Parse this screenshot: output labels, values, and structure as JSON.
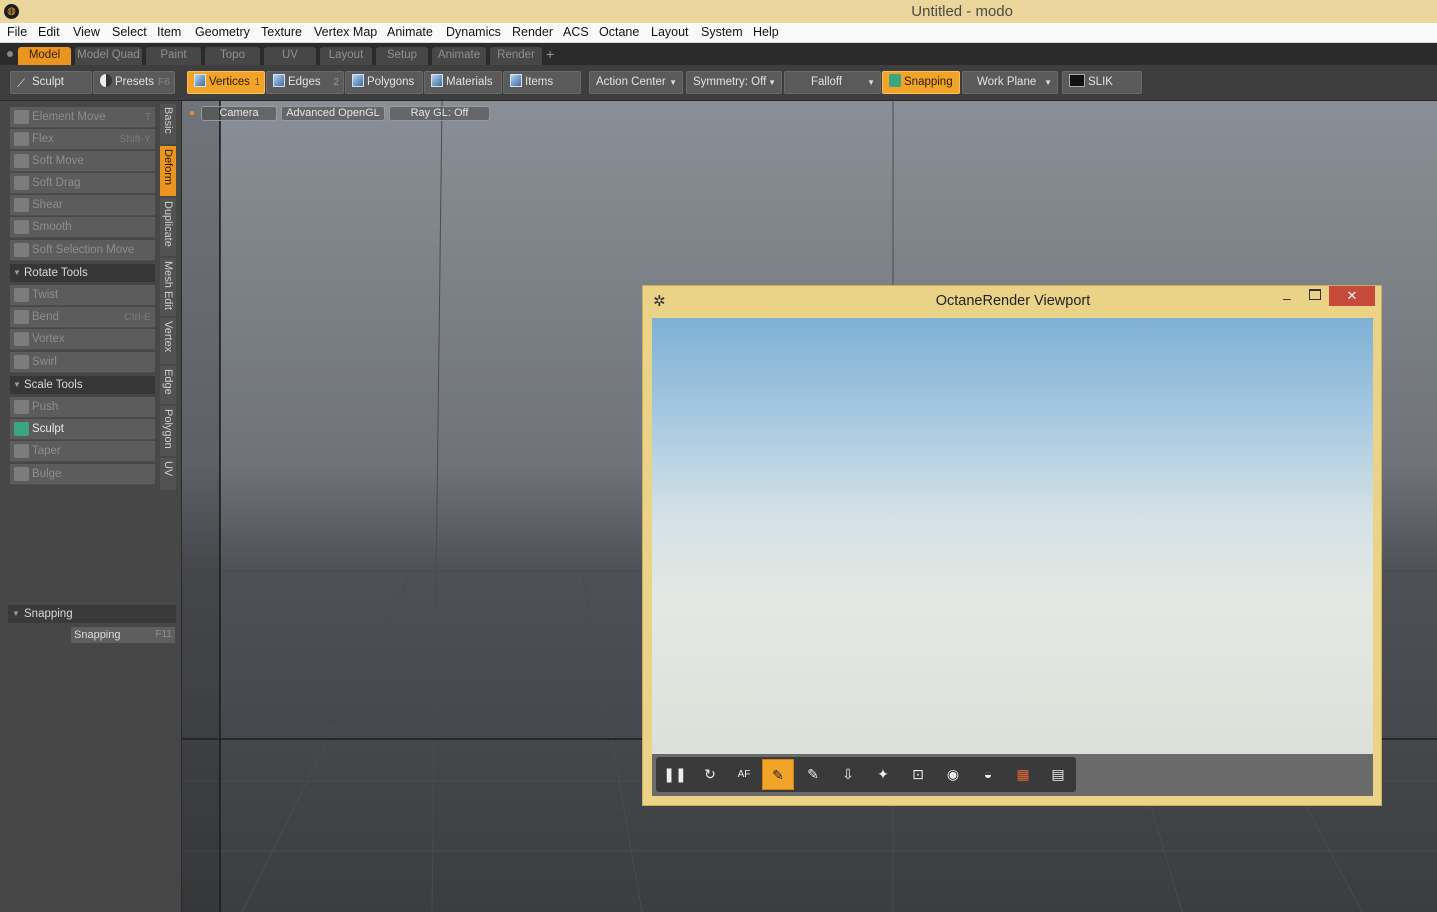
{
  "window": {
    "title": "Untitled - modo",
    "app_logo": "modo-logo-icon"
  },
  "menu": [
    "File",
    "Edit",
    "View",
    "Select",
    "Item",
    "Geometry",
    "Texture",
    "Vertex Map",
    "Animate",
    "Dynamics",
    "Render",
    "ACS",
    "Octane",
    "Layout",
    "System",
    "Help"
  ],
  "layout_tabs": {
    "items": [
      "Model",
      "Model Quad",
      "Paint",
      "Topo",
      "UV",
      "Layout",
      "Setup",
      "Animate",
      "Render"
    ],
    "active": "Model",
    "add": "+"
  },
  "toolbar": {
    "sculpt": "Sculpt",
    "presets": "Presets",
    "presets_key": "F6",
    "vertices": "Vertices",
    "vertices_num": "1",
    "edges": "Edges",
    "edges_num": "2",
    "polygons": "Polygons",
    "materials": "Materials",
    "items": "Items",
    "action_center": "Action Center",
    "symmetry": "Symmetry: Off",
    "falloff": "Falloff",
    "snapping": "Snapping",
    "work_plane": "Work Plane",
    "slik": "SLIK"
  },
  "left_panel": {
    "tools_top": [
      {
        "label": "Element Move",
        "key": "T"
      },
      {
        "label": "Flex",
        "key": "Shift-Y"
      },
      {
        "label": "Soft Move",
        "key": ""
      },
      {
        "label": "Soft Drag",
        "key": ""
      },
      {
        "label": "Shear",
        "key": ""
      },
      {
        "label": "Smooth",
        "key": ""
      },
      {
        "label": "Soft Selection Move",
        "key": ""
      }
    ],
    "rotate_group": "Rotate Tools",
    "rotate_tools": [
      {
        "label": "Twist",
        "key": ""
      },
      {
        "label": "Bend",
        "key": "Ctrl-E"
      },
      {
        "label": "Vortex",
        "key": ""
      },
      {
        "label": "Swirl",
        "key": ""
      }
    ],
    "scale_group": "Scale Tools",
    "scale_tools": [
      {
        "label": "Push",
        "key": ""
      },
      {
        "label": "Sculpt",
        "key": ""
      },
      {
        "label": "Taper",
        "key": ""
      },
      {
        "label": "Bulge",
        "key": ""
      }
    ],
    "vertical_tabs": [
      "Basic",
      "Deform",
      "Duplicate",
      "Mesh Edit",
      "Vertex",
      "Edge",
      "Polygon",
      "UV"
    ],
    "active_vtab": "Deform",
    "snapping_group": "Snapping",
    "snapping_button": "Snapping",
    "snapping_key": "F11"
  },
  "viewport": {
    "camera": "Camera",
    "shading": "Advanced OpenGL",
    "raygl": "Ray GL: Off"
  },
  "octane": {
    "title": "OctaneRender Viewport",
    "minimize": "–",
    "close": "✕",
    "tools": [
      "pause-icon",
      "restart-icon",
      "autofocus-icon",
      "pick-focus-icon",
      "pick-white-balance-icon",
      "pick-material-icon",
      "pick-object-icon",
      "region-render-icon",
      "camera-icon",
      "clay-mode-icon",
      "color-swatch-icon",
      "settings-sheet-icon"
    ],
    "autofocus_label": "AF"
  },
  "colors": {
    "accent": "#e9951f",
    "octane_frame": "#ead386",
    "close_red": "#c74b3c",
    "titlebar": "#ead69a"
  }
}
